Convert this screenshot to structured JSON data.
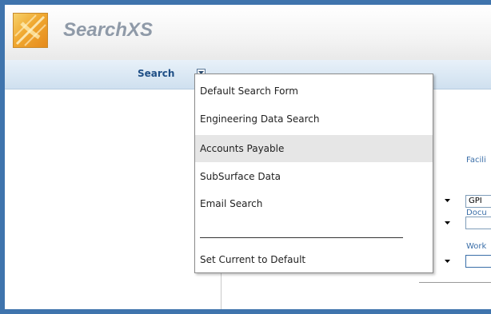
{
  "app": {
    "name": "SearchXS"
  },
  "navbar": {
    "search_label": "Search",
    "menu_icon": "dropdown-arrow-icon"
  },
  "form": {
    "fields": [
      {
        "label": "Facili",
        "value": "GPI"
      },
      {
        "label": "Docu",
        "value": ""
      },
      {
        "label": "Work",
        "value": ""
      }
    ]
  },
  "search_menu": {
    "items": [
      {
        "label": "Default Search Form",
        "highlighted": false
      },
      {
        "label": "Engineering Data Search",
        "highlighted": false
      },
      {
        "label": "Accounts Payable",
        "highlighted": true
      },
      {
        "label": "SubSurface Data",
        "highlighted": false
      },
      {
        "label": "Email Search",
        "highlighted": false
      }
    ],
    "footer_item": "Set Current to Default"
  },
  "colors": {
    "frame": "#3f74ad",
    "link_blue": "#1f4f86",
    "menu_highlight": "#e6e6e6"
  }
}
